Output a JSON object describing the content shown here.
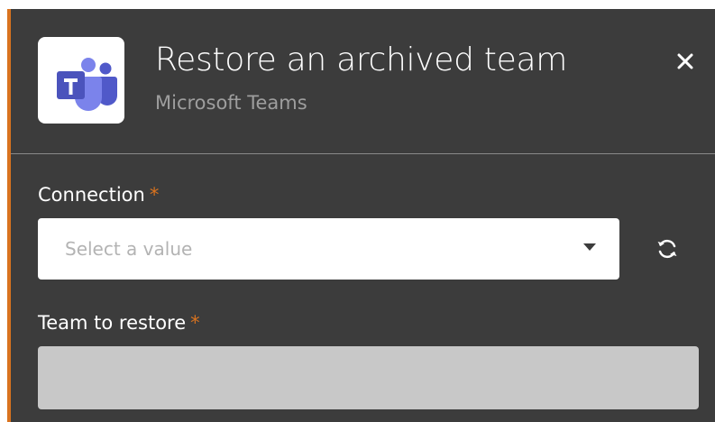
{
  "dialog": {
    "title": "Restore an archived team",
    "subtitle": "Microsoft Teams",
    "app_icon": "microsoft-teams-logo",
    "close_icon": "close-icon",
    "accent_color": "#d9731f",
    "background_color": "#3c3c3c"
  },
  "form": {
    "connection": {
      "label": "Connection",
      "required_marker": "*",
      "placeholder": "Select a value",
      "dropdown_icon": "caret-down-icon",
      "refresh_icon": "refresh-icon"
    },
    "team_to_restore": {
      "label": "Team to restore",
      "required_marker": "*",
      "value": ""
    }
  }
}
